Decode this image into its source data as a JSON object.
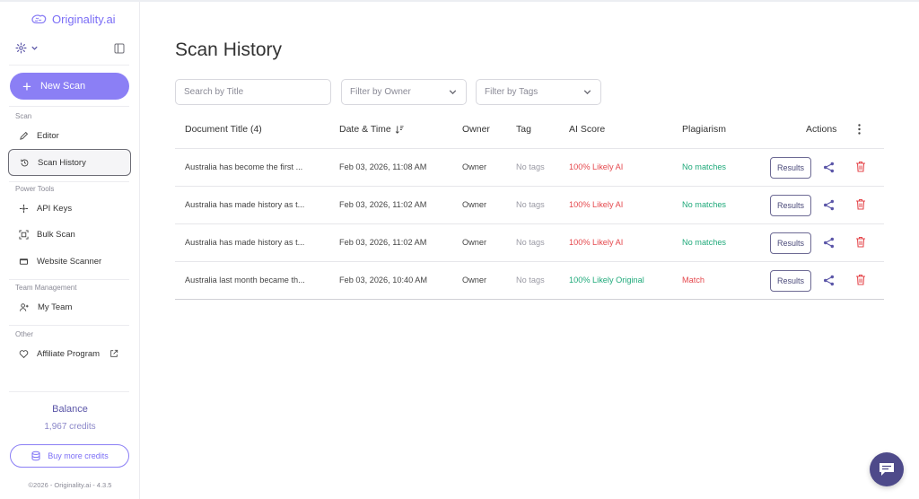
{
  "brand": {
    "name": "Originality.ai"
  },
  "sidebar": {
    "new_scan_label": "New Scan",
    "sections": {
      "scan": "Scan",
      "power_tools": "Power Tools",
      "team_management": "Team Management",
      "other": "Other"
    },
    "items": {
      "editor": "Editor",
      "scan_history": "Scan History",
      "api_keys": "API Keys",
      "bulk_scan": "Bulk Scan",
      "website_scanner": "Website Scanner",
      "my_team": "My Team",
      "affiliate_program": "Affiliate Program"
    },
    "balance": {
      "title": "Balance",
      "credits": "1,967 credits"
    },
    "buy_label": "Buy more credits",
    "footer": "©2026 - Originality.ai - 4.3.5"
  },
  "main": {
    "title": "Scan History",
    "filters": {
      "search_placeholder": "Search by Title",
      "owner_placeholder": "Filter by Owner",
      "tags_placeholder": "Filter by Tags"
    },
    "columns": {
      "document_title": "Document Title (4)",
      "date_time": "Date & Time",
      "owner": "Owner",
      "tag": "Tag",
      "ai_score": "AI Score",
      "plagiarism": "Plagiarism",
      "actions": "Actions"
    },
    "rows": [
      {
        "title": "Australia has become the first ...",
        "date": "Feb 03, 2026, 11:08 AM",
        "owner": "Owner",
        "tag": "No tags",
        "ai_score": "100% Likely AI",
        "plagiarism": "No matches",
        "results": "Results"
      },
      {
        "title": "Australia has made history as t...",
        "date": "Feb 03, 2026, 11:02 AM",
        "owner": "Owner",
        "tag": "No tags",
        "ai_score": "100% Likely AI",
        "plagiarism": "No matches",
        "results": "Results"
      },
      {
        "title": "Australia has made history as t...",
        "date": "Feb 03, 2026, 11:02 AM",
        "owner": "Owner",
        "tag": "No tags",
        "ai_score": "100% Likely AI",
        "plagiarism": "No matches",
        "results": "Results"
      },
      {
        "title": "Australia last month became th...",
        "date": "Feb 03, 2026, 10:40 AM",
        "owner": "Owner",
        "tag": "No tags",
        "ai_score": "100% Likely Original",
        "plagiarism": "Match",
        "results": "Results"
      }
    ]
  },
  "colors": {
    "accent": "#8b7ff5",
    "danger": "#e5484d",
    "success": "#1fa97a",
    "chat_bubble": "#4e4a8a"
  }
}
